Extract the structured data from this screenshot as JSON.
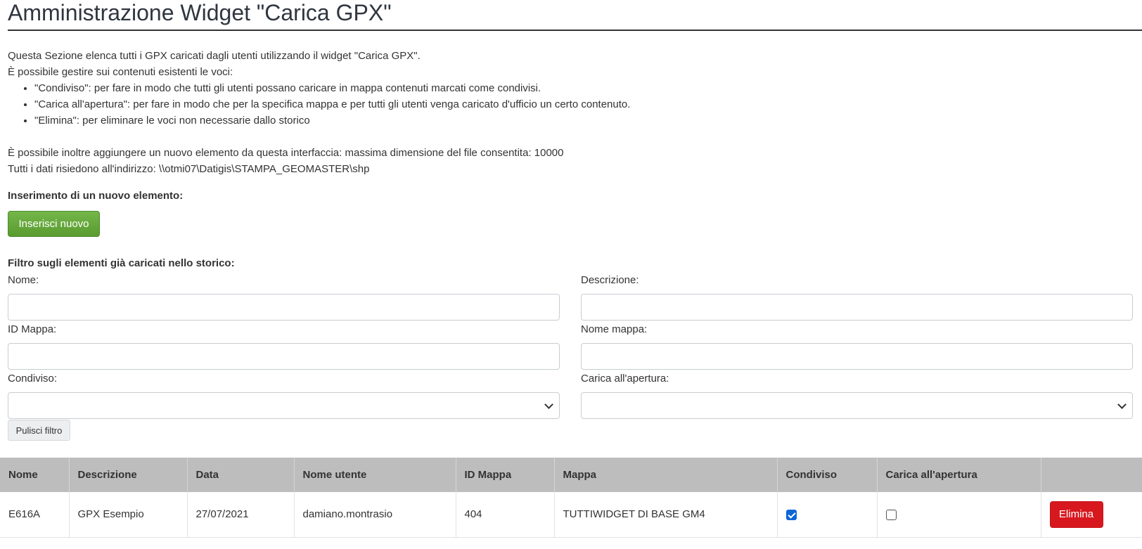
{
  "page": {
    "title": "Amministrazione Widget \"Carica GPX\"",
    "intro": "Questa Sezione elenca tutti i GPX caricati dagli utenti utilizzando il widget \"Carica GPX\".",
    "manage_text": "È possibile gestire sui contenuti esistenti le voci:",
    "bullets": [
      "\"Condiviso\": per fare in modo che tutti gli utenti possano caricare in mappa contenuti marcati come condivisi.",
      "\"Carica all'apertura\": per fare in modo che per la specifica mappa e per tutti gli utenti venga caricato d'ufficio un certo contenuto.",
      "\"Elimina\": per eliminare le voci non necessarie dallo storico"
    ],
    "add_info": "È possibile inoltre aggiungere un nuovo elemento da questa interfaccia: massima dimensione del file consentita: 10000",
    "path_info": "Tutti i dati risiedono all'indirizzo: \\\\otmi07\\Datigis\\STAMPA_GEOMASTER\\shp"
  },
  "insert": {
    "label": "Inserimento di un nuovo elemento:",
    "button": "Inserisci nuovo"
  },
  "filter": {
    "label": "Filtro sugli elementi già caricati nello storico:",
    "nome_label": "Nome:",
    "nome_value": "",
    "descrizione_label": "Descrizione:",
    "descrizione_value": "",
    "id_mappa_label": "ID Mappa:",
    "id_mappa_value": "",
    "nome_mappa_label": "Nome mappa:",
    "nome_mappa_value": "",
    "condiviso_label": "Condiviso:",
    "condiviso_value": "",
    "carica_label": "Carica all'apertura:",
    "carica_value": "",
    "clear_button": "Pulisci filtro"
  },
  "table": {
    "headers": [
      "Nome",
      "Descrizione",
      "Data",
      "Nome utente",
      "ID Mappa",
      "Mappa",
      "Condiviso",
      "Carica all'apertura",
      ""
    ],
    "rows": [
      {
        "nome": "E616A",
        "descrizione": "GPX Esempio",
        "data": "27/07/2021",
        "utente": "damiano.montrasio",
        "id_mappa": "404",
        "mappa": "TUTTIWIDGET DI BASE GM4",
        "condiviso": true,
        "carica": false,
        "delete_label": "Elimina"
      }
    ]
  },
  "colors": {
    "insert_button": "#5fa33a",
    "delete_button": "#d7191f",
    "table_header": "#bdbdbd",
    "checkbox_checked": "#0b66d6"
  }
}
